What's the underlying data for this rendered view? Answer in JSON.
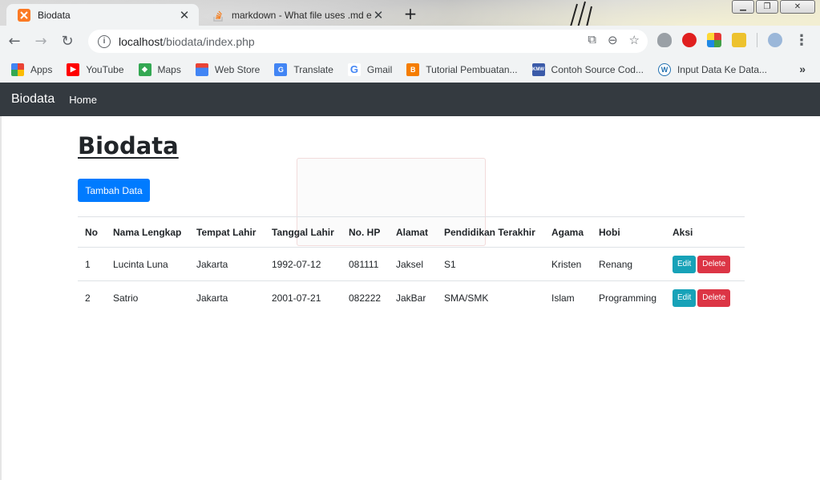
{
  "browser": {
    "tabs": [
      {
        "title": "Biodata",
        "active": true,
        "icon": "xampp-icon",
        "color": "#fb7a24"
      },
      {
        "title": "markdown - What file uses .md e",
        "active": false,
        "icon": "stackoverflow-icon",
        "color": "#f48024"
      }
    ],
    "address": {
      "host": "localhost",
      "path": "/biodata/index.php"
    },
    "bookmarks": [
      {
        "label": "Apps",
        "icon": "apps-grid-icon"
      },
      {
        "label": "YouTube",
        "icon": "youtube-icon",
        "color": "#ff0000"
      },
      {
        "label": "Maps",
        "icon": "maps-icon",
        "color": "#34a853"
      },
      {
        "label": "Web Store",
        "icon": "webstore-icon",
        "color": "#4285f4"
      },
      {
        "label": "Translate",
        "icon": "translate-icon",
        "color": "#4285f4"
      },
      {
        "label": "Gmail",
        "icon": "google-icon",
        "color": "#ea4335"
      },
      {
        "label": "Tutorial Pembuatan...",
        "icon": "blogger-icon",
        "color": "#f57d00"
      },
      {
        "label": "Contoh Source Cod...",
        "icon": "kmw-icon",
        "color": "#3b5ba9"
      },
      {
        "label": "Input Data Ke Data...",
        "icon": "wordpress-icon",
        "color": "#2271b1"
      }
    ]
  },
  "navbar": {
    "brand": "Biodata",
    "home": "Home"
  },
  "page": {
    "title": "Biodata",
    "add_button": "Tambah Data"
  },
  "table": {
    "headers": [
      "No",
      "Nama Lengkap",
      "Tempat Lahir",
      "Tanggal Lahir",
      "No. HP",
      "Alamat",
      "Pendidikan Terakhir",
      "Agama",
      "Hobi",
      "Aksi"
    ],
    "rows": [
      {
        "no": "1",
        "nama": "Lucinta Luna",
        "tempat": "Jakarta",
        "tanggal": "1992-07-12",
        "hp": "081111",
        "alamat": "Jaksel",
        "pendidikan": "S1",
        "agama": "Kristen",
        "hobi": "Renang",
        "edit": "Edit",
        "delete": "Delete"
      },
      {
        "no": "2",
        "nama": "Satrio",
        "tempat": "Jakarta",
        "tanggal": "2001-07-21",
        "hp": "082222",
        "alamat": "JakBar",
        "pendidikan": "SMA/SMK",
        "agama": "Islam",
        "hobi": "Programming",
        "edit": "Edit",
        "delete": "Delete"
      }
    ]
  },
  "colors": {
    "navbar": "#343a40",
    "primary": "#007bff",
    "info": "#17a2b8",
    "danger": "#dc3545"
  }
}
